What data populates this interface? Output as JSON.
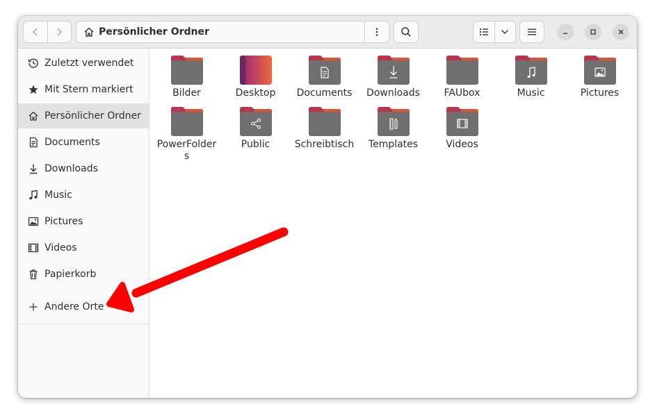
{
  "header": {
    "path_title": "Persönlicher Ordner",
    "icons": {
      "back": "chevron-left-icon",
      "forward": "chevron-right-icon",
      "home": "home-icon",
      "path_menu": "vertical-dots-icon",
      "search": "search-icon",
      "view_list": "list-view-icon",
      "view_options": "chevron-down-icon",
      "main_menu": "hamburger-icon",
      "minimize": "minimize-icon",
      "maximize": "maximize-icon",
      "close": "close-icon"
    }
  },
  "sidebar": {
    "items": [
      {
        "label": "Zuletzt verwendet",
        "icon": "clock-icon"
      },
      {
        "label": "Mit Stern markiert",
        "icon": "star-icon"
      },
      {
        "label": "Persönlicher Ordner",
        "icon": "home-icon",
        "active": true
      },
      {
        "label": "Documents",
        "icon": "document-icon"
      },
      {
        "label": "Downloads",
        "icon": "download-icon"
      },
      {
        "label": "Music",
        "icon": "music-icon"
      },
      {
        "label": "Pictures",
        "icon": "picture-icon"
      },
      {
        "label": "Videos",
        "icon": "film-icon"
      },
      {
        "label": "Papierkorb",
        "icon": "trash-icon"
      }
    ],
    "other_places": {
      "label": "Andere Orte",
      "icon": "plus-icon"
    }
  },
  "folders": [
    {
      "label": "Bilder",
      "icon": "folder-icon"
    },
    {
      "label": "Desktop",
      "icon": "desktop-folder-icon"
    },
    {
      "label": "Documents",
      "icon": "documents-folder-icon"
    },
    {
      "label": "Downloads",
      "icon": "downloads-folder-icon"
    },
    {
      "label": "FAUbox",
      "icon": "folder-icon"
    },
    {
      "label": "Music",
      "icon": "music-folder-icon"
    },
    {
      "label": "Pictures",
      "icon": "pictures-folder-icon"
    },
    {
      "label": "PowerFolders",
      "icon": "folder-icon"
    },
    {
      "label": "Public",
      "icon": "public-folder-icon"
    },
    {
      "label": "Schreibtisch",
      "icon": "folder-icon"
    },
    {
      "label": "Templates",
      "icon": "templates-folder-icon"
    },
    {
      "label": "Videos",
      "icon": "videos-folder-icon"
    }
  ],
  "colors": {
    "folder_tab": "#b8344f",
    "folder_tab_accent": "#e9572e",
    "folder_body": "#6f6f6f",
    "annotation_arrow": "#ff0000"
  }
}
